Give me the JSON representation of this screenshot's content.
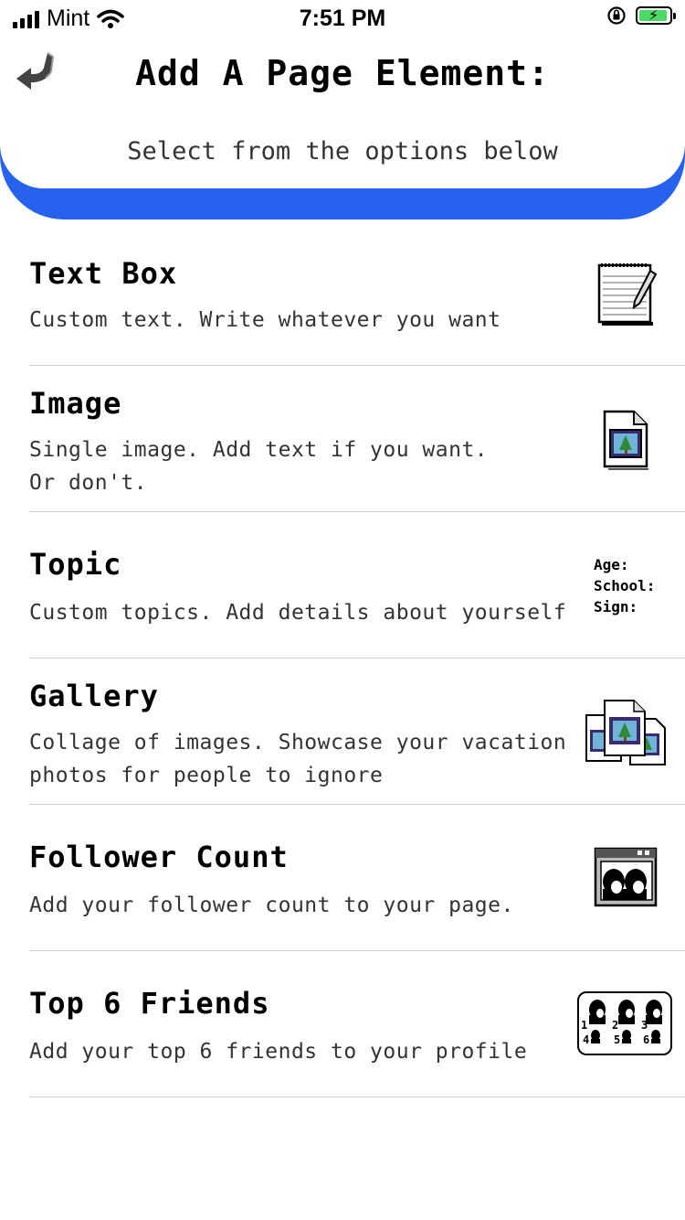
{
  "status_bar": {
    "carrier": "Mint",
    "time": "7:51 PM",
    "battery_color": "#4cd964"
  },
  "header": {
    "title": "Add A Page Element:",
    "subtitle": "Select from the options below",
    "accent_color": "#2762ee",
    "back_icon": "back-arrow-icon"
  },
  "options": [
    {
      "title": "Text Box",
      "description": "Custom text. Write whatever you want",
      "icon": "notepad-icon"
    },
    {
      "title": "Image",
      "description": "Single image. Add text if you want.\nOr don't.",
      "icon": "image-file-icon"
    },
    {
      "title": "Topic",
      "description": "Custom topics. Add details about yourself",
      "icon": "topic-fields-icon",
      "icon_text": [
        "Age:",
        "School:",
        "Sign:"
      ]
    },
    {
      "title": "Gallery",
      "description": "Collage of images. Showcase your vacation\nphotos for people to ignore",
      "icon": "gallery-icon"
    },
    {
      "title": "Follower Count",
      "description": "Add your follower count to your page.",
      "icon": "followers-window-icon"
    },
    {
      "title": "Top 6 Friends",
      "description": "Add your top 6 friends to your profile",
      "icon": "top-friends-icon",
      "icon_text": [
        "1",
        "2",
        "3",
        "4",
        "5",
        "6"
      ]
    }
  ]
}
